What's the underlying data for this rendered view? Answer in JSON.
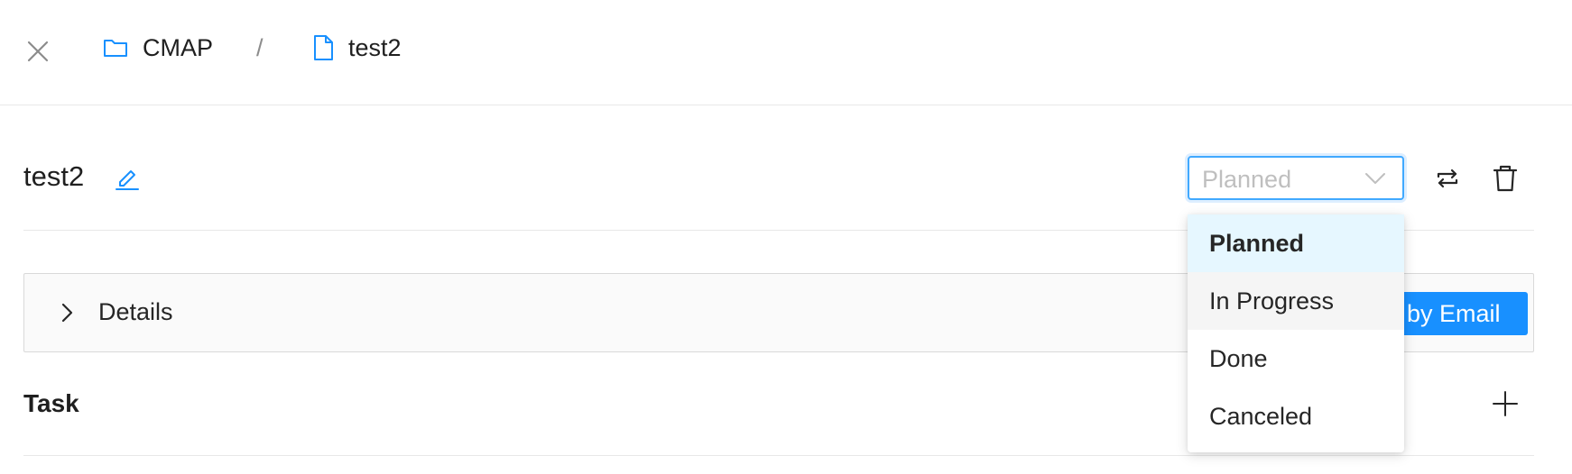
{
  "breadcrumb": {
    "items": [
      {
        "label": "CMAP",
        "icon": "folder-icon"
      },
      {
        "label": "test2",
        "icon": "file-icon"
      }
    ],
    "separator": "/"
  },
  "header": {
    "title": "test2"
  },
  "status": {
    "selected": "Planned",
    "options": [
      "Planned",
      "In Progress",
      "Done",
      "Canceled"
    ]
  },
  "details": {
    "label": "Details",
    "email_button_label": "by Email"
  },
  "task": {
    "label": "Task"
  },
  "colors": {
    "accent": "#1890ff",
    "selected_option_bg": "#e6f7ff"
  }
}
